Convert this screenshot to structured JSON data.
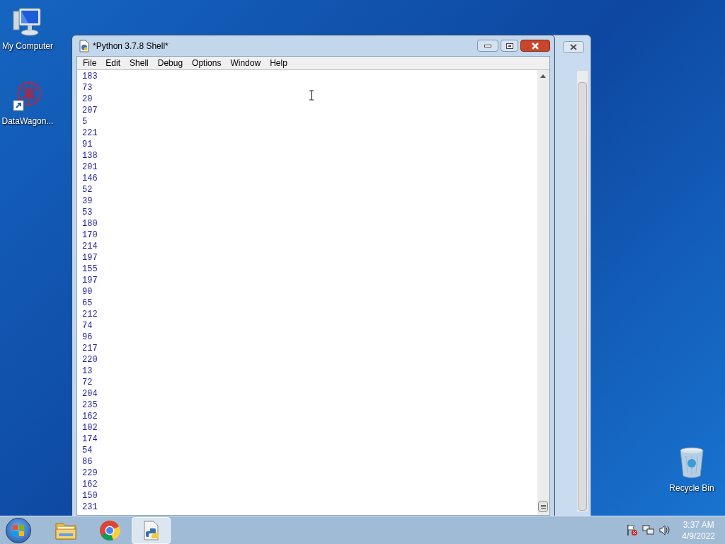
{
  "desktop_icons": [
    {
      "label": "My Computer",
      "kind": "computer"
    },
    {
      "label": "DataWagon...",
      "kind": "shortcut"
    },
    {
      "label": "Recycle Bin",
      "kind": "bin"
    }
  ],
  "window": {
    "title": "*Python 3.7.8 Shell*",
    "menu": [
      "File",
      "Edit",
      "Shell",
      "Debug",
      "Options",
      "Window",
      "Help"
    ],
    "shell_lines": [
      "183",
      "73",
      "20",
      "207",
      "5",
      "221",
      "91",
      "138",
      "201",
      "146",
      "52",
      "39",
      "53",
      "180",
      "170",
      "214",
      "197",
      "155",
      "197",
      "90",
      "65",
      "212",
      "74",
      "96",
      "217",
      "220",
      "13",
      "72",
      "204",
      "235",
      "162",
      "102",
      "174",
      "54",
      "86",
      "229",
      "162",
      "150",
      "231"
    ]
  },
  "taskbar": {
    "items": [
      {
        "kind": "folder",
        "selected": false
      },
      {
        "kind": "chrome",
        "selected": false
      },
      {
        "kind": "python",
        "selected": true
      }
    ],
    "clock": {
      "time": "3:37 AM",
      "date": "4/9/2022"
    }
  }
}
